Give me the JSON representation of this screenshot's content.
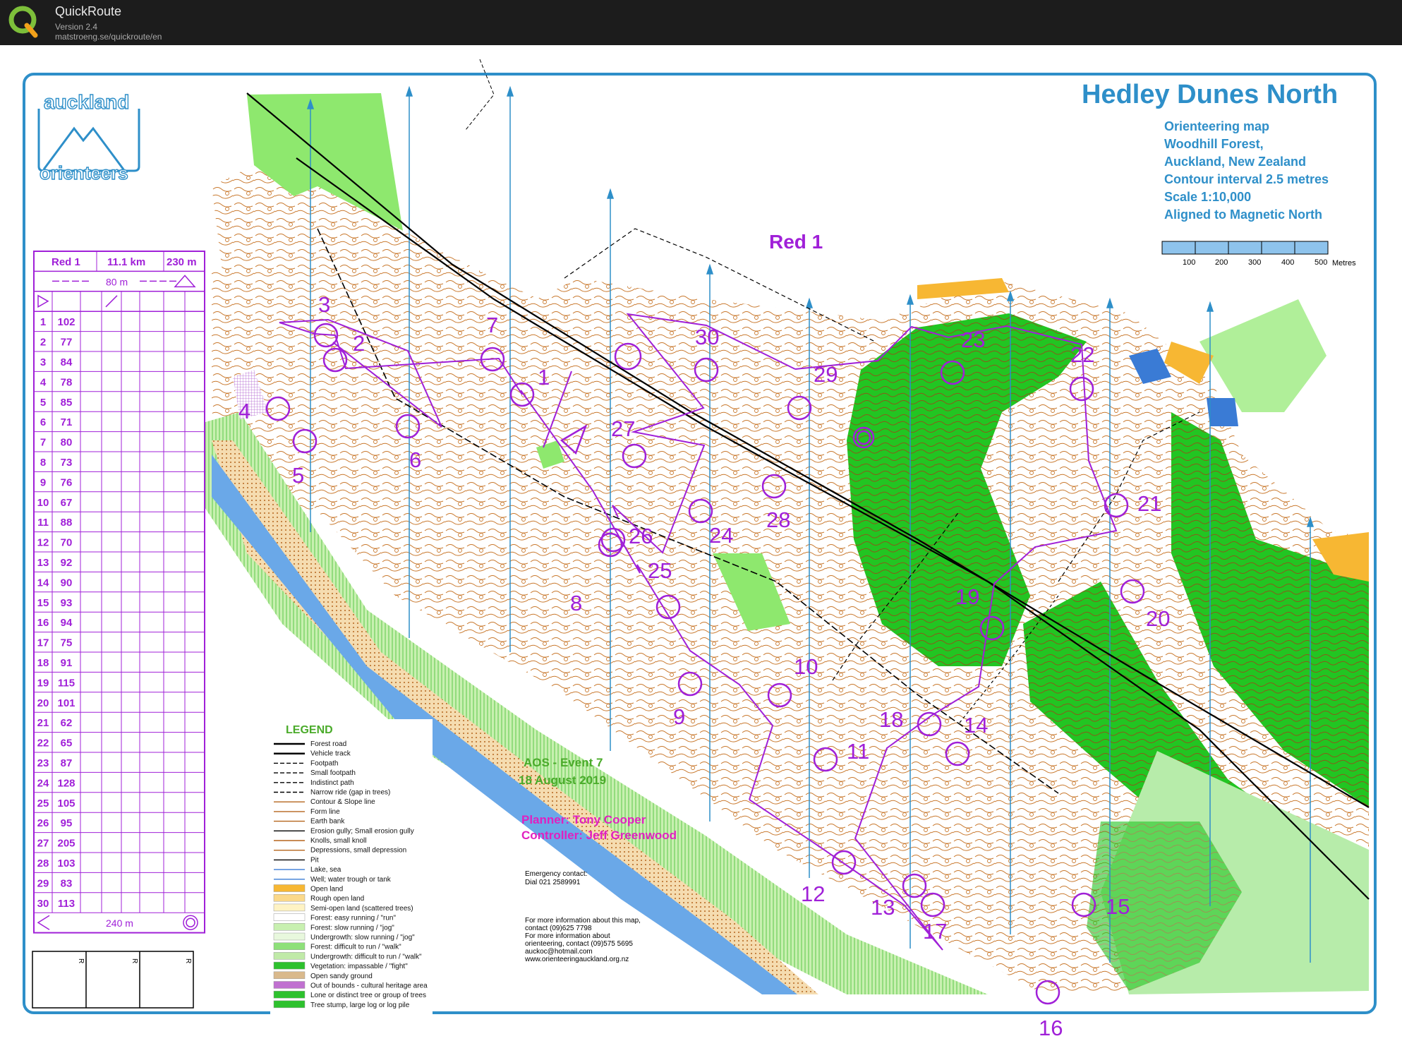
{
  "app": {
    "name": "QuickRoute",
    "version": "Version 2.4",
    "url": "matstroeng.se/quickroute/en"
  },
  "map": {
    "title": "Hedley Dunes North",
    "subtitle_lines": [
      "Orienteering map",
      "Woodhill Forest,",
      "Auckland, New Zealand",
      "Contour interval 2.5 metres",
      "Scale 1:10,000",
      "Aligned to Magnetic North"
    ],
    "scale_bar": {
      "ticks": [
        "100",
        "200",
        "300",
        "400",
        "500"
      ],
      "unit": "Metres"
    },
    "club_logo": {
      "top": "auckland",
      "bottom": "orienteers"
    },
    "course_name": "Red 1",
    "event": "AOS - Event 7",
    "date": "18 August 2019",
    "planner": "Planner: Tony Cooper",
    "controller": "Controller: Jeff Greenwood",
    "emergency": [
      "Emergency contact:",
      "Dial 021 2589991"
    ],
    "info": [
      "For more information about this map,",
      "contact (09)625 7798",
      "For more information about",
      "orienteering, contact (09)575 5695",
      "auckoc@hotmail.com",
      "www.orienteeringauckland.org.nz"
    ],
    "control_labels": [
      "1",
      "2",
      "3",
      "4",
      "5",
      "6",
      "7",
      "8",
      "9",
      "10",
      "11",
      "12",
      "13",
      "14",
      "15",
      "16",
      "17",
      "18",
      "19",
      "20",
      "21",
      "22",
      "23",
      "24",
      "25",
      "26",
      "27",
      "28",
      "29",
      "30"
    ]
  },
  "descriptions": {
    "header": {
      "course": "Red 1",
      "length": "11.1 km",
      "climb": "230 m"
    },
    "start_tape": "80 m",
    "finish_tape": "240 m",
    "rows": [
      {
        "n": "1",
        "code": "102"
      },
      {
        "n": "2",
        "code": "77"
      },
      {
        "n": "3",
        "code": "84"
      },
      {
        "n": "4",
        "code": "78"
      },
      {
        "n": "5",
        "code": "85"
      },
      {
        "n": "6",
        "code": "71"
      },
      {
        "n": "7",
        "code": "80"
      },
      {
        "n": "8",
        "code": "73"
      },
      {
        "n": "9",
        "code": "76"
      },
      {
        "n": "10",
        "code": "67"
      },
      {
        "n": "11",
        "code": "88"
      },
      {
        "n": "12",
        "code": "70"
      },
      {
        "n": "13",
        "code": "92"
      },
      {
        "n": "14",
        "code": "90"
      },
      {
        "n": "15",
        "code": "93"
      },
      {
        "n": "16",
        "code": "94"
      },
      {
        "n": "17",
        "code": "75"
      },
      {
        "n": "18",
        "code": "91"
      },
      {
        "n": "19",
        "code": "115"
      },
      {
        "n": "20",
        "code": "101"
      },
      {
        "n": "21",
        "code": "62"
      },
      {
        "n": "22",
        "code": "65"
      },
      {
        "n": "23",
        "code": "87"
      },
      {
        "n": "24",
        "code": "128"
      },
      {
        "n": "25",
        "code": "105"
      },
      {
        "n": "26",
        "code": "95"
      },
      {
        "n": "27",
        "code": "205"
      },
      {
        "n": "28",
        "code": "103"
      },
      {
        "n": "29",
        "code": "83"
      },
      {
        "n": "30",
        "code": "113"
      }
    ],
    "r_boxes": [
      "R",
      "R",
      "R"
    ]
  },
  "legend": {
    "title": "LEGEND",
    "items": [
      "Forest road",
      "Vehicle track",
      "Footpath",
      "Small footpath",
      "Indistinct path",
      "Narrow ride (gap in trees)",
      "Contour & Slope line",
      "Form line",
      "Earth bank",
      "Erosion gully; Small erosion gully",
      "Knolls, small knoll",
      "Depressions, small depression",
      "Pit",
      "Lake, sea",
      "Well; water trough or tank",
      "Open land",
      "Rough open land",
      "Semi-open land (scattered trees)",
      "Forest: easy running / \"run\"",
      "Forest: slow running / \"jog\"",
      "Undergrowth: slow running / \"jog\"",
      "Forest: difficult to run / \"walk\"",
      "Undergrowth: difficult to run / \"walk\"",
      "Vegetation: impassable / \"fight\"",
      "Open sandy ground",
      "Out of bounds - cultural heritage area",
      "Lone or distinct tree or group of trees",
      "Tree stump, large log or log pile"
    ],
    "swatches": [
      "#000000",
      "#000000",
      "#000000",
      "#000000",
      "#000000",
      "#000000",
      "#b5651d",
      "#b5651d",
      "#b5651d",
      "#000000",
      "#b5651d",
      "#b5651d",
      "#000000",
      "#3a7bd5",
      "#3a7bd5",
      "#f7b733",
      "#fbd98a",
      "#fff3c4",
      "#ffffff",
      "#c8f0b0",
      "#e8f8dd",
      "#8ee07a",
      "#c0eaa8",
      "#2dc12d",
      "#d9b98c",
      "#c070d0",
      "#2dc12d",
      "#2dc12d"
    ]
  },
  "colors": {
    "course": "#a020d8",
    "frame": "#2e8fc9",
    "title_blue": "#2e8fc9",
    "event_green": "#4aab2a",
    "planner_magenta": "#e020c0",
    "green_dark": "#22c522",
    "green_light": "#8ee86e",
    "water": "#6aa8e8",
    "contour": "#b5651d"
  }
}
